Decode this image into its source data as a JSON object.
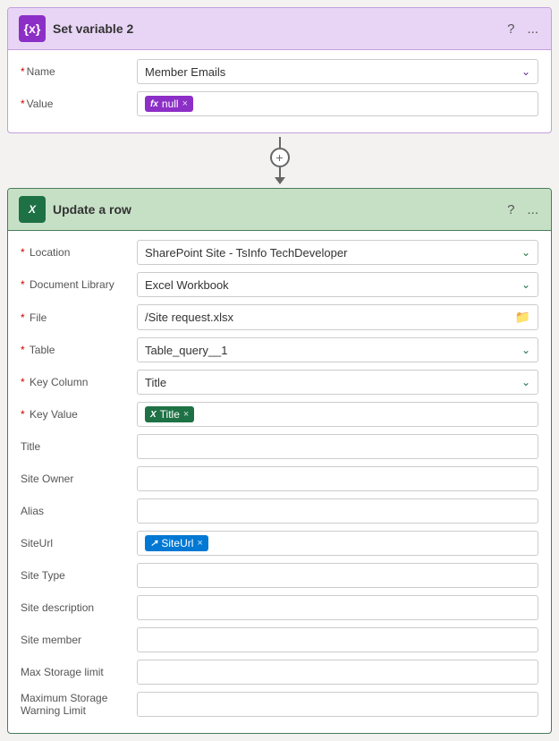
{
  "set_variable_card": {
    "icon_label": "{x}",
    "title": "Set variable 2",
    "help_icon": "?",
    "more_icon": "...",
    "fields": [
      {
        "label": "Name",
        "required": true,
        "type": "dropdown",
        "value": "Member Emails"
      },
      {
        "label": "Value",
        "required": true,
        "type": "token",
        "token_type": "purple",
        "token_icon": "fx",
        "token_text": "null"
      }
    ]
  },
  "connector": {
    "plus_label": "+",
    "arrow": "▼"
  },
  "update_card": {
    "icon_label": "X",
    "title": "Update a row",
    "help_icon": "?",
    "more_icon": "...",
    "fields": [
      {
        "label": "Location",
        "required": true,
        "type": "dropdown",
        "value": "SharePoint Site - TsInfo TechDeveloper"
      },
      {
        "label": "Document Library",
        "required": true,
        "type": "dropdown",
        "value": "Excel Workbook"
      },
      {
        "label": "File",
        "required": true,
        "type": "folder-input",
        "value": "/Site request.xlsx"
      },
      {
        "label": "Table",
        "required": true,
        "type": "dropdown",
        "value": "Table_query__1"
      },
      {
        "label": "Key Column",
        "required": true,
        "type": "dropdown",
        "value": "Title"
      },
      {
        "label": "Key Value",
        "required": true,
        "type": "token-green",
        "token_icon": "X",
        "token_text": "Title"
      },
      {
        "label": "Title",
        "required": false,
        "type": "empty",
        "value": ""
      },
      {
        "label": "Site Owner",
        "required": false,
        "type": "empty",
        "value": ""
      },
      {
        "label": "Alias",
        "required": false,
        "type": "empty",
        "value": ""
      },
      {
        "label": "SiteUrl",
        "required": false,
        "type": "token-blue",
        "token_icon": "↗",
        "token_text": "SiteUrl"
      },
      {
        "label": "Site Type",
        "required": false,
        "type": "empty",
        "value": ""
      },
      {
        "label": "Site description",
        "required": false,
        "type": "empty",
        "value": ""
      },
      {
        "label": "Site member",
        "required": false,
        "type": "empty",
        "value": ""
      },
      {
        "label": "Max Storage limit",
        "required": false,
        "type": "empty",
        "value": ""
      },
      {
        "label": "Maximum Storage Warning Limit",
        "required": false,
        "type": "empty",
        "value": ""
      }
    ]
  }
}
